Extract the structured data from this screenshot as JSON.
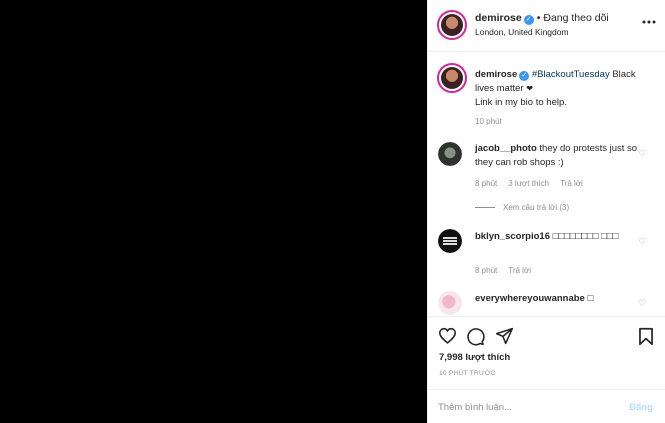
{
  "header": {
    "username": "demirose",
    "dot": "•",
    "follow_status": "Đang theo dõi",
    "location": "London, United Kingdom",
    "more_icon": "more-horizontal-icon"
  },
  "caption": {
    "username": "demirose",
    "hashtag": "#BlackoutTuesday",
    "text_1": " Black lives matter ",
    "heart": "❤",
    "text_2": "Link in my bio to help.",
    "time": "10 phút"
  },
  "comments": [
    {
      "username": "jacob__photo",
      "text": " they do protests just so they can rob shops :)",
      "time": "8 phút",
      "likes": "3 lượt thích",
      "reply_label": "Trả lời",
      "view_replies": "Xem câu trả lời (3)"
    },
    {
      "username": "bklyn_scorpio16",
      "text": " □□□□□□□□ □□□",
      "time": "8 phút",
      "reply_label": "Trả lời"
    },
    {
      "username": "everywhereyouwannabe",
      "text": " □"
    }
  ],
  "likes_count": "7,998 lượt thích",
  "post_time": "10 PHÚT TRƯỚC",
  "add_comment": {
    "placeholder": "Thêm bình luận...",
    "post_label": "Đăng"
  },
  "colors": {
    "verified": "#3897f0",
    "hashtag": "#00376b",
    "post_button_disabled": "#b2dffc",
    "story_ring": "#d6249f"
  }
}
